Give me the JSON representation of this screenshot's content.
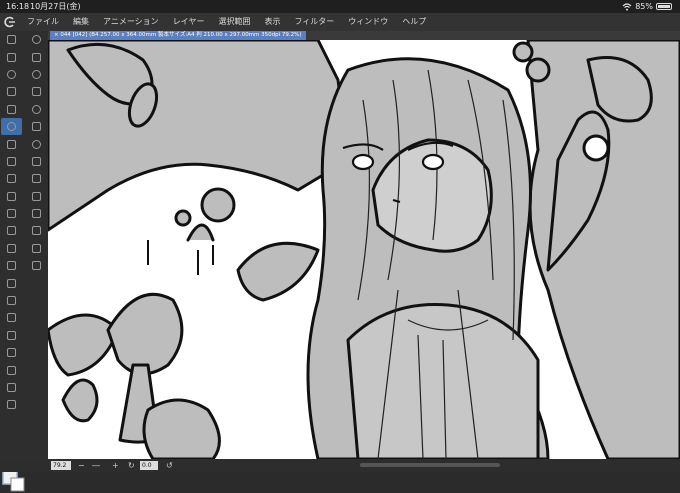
{
  "status": {
    "time": "16:18",
    "date": "10月27日(金)",
    "battery": "85%",
    "battery_level": 0.85,
    "wifi_icon": "wifi-icon"
  },
  "menu": {
    "logo_icon": "clip-studio-logo-icon",
    "items": [
      "ファイル",
      "編集",
      "アニメーション",
      "レイヤー",
      "選択範囲",
      "表示",
      "フィルター",
      "ウィンドウ",
      "ヘルプ"
    ]
  },
  "document": {
    "title": "× 044 [042] (B4 257.00 x 364.00mm 製本サイズ:A4 判 210.00 x 297.00mm 350dpi 79.2%)",
    "zoom_value": "79.2",
    "angle_value": "0.0"
  },
  "colors": {
    "accent": "#5b7fc0",
    "canvas_gray": "#bdbdbd",
    "line": "#111111"
  }
}
